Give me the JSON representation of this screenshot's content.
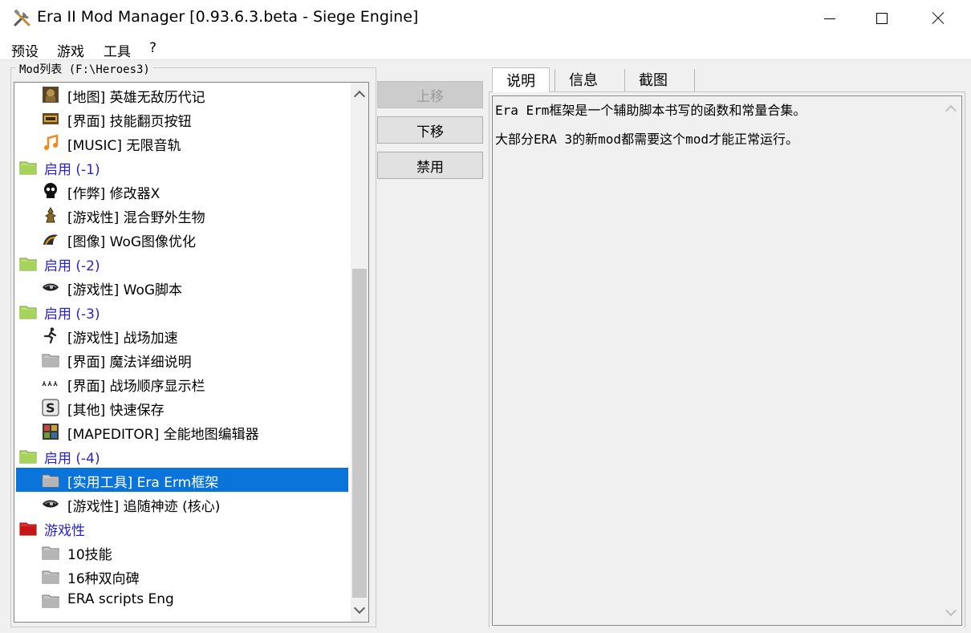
{
  "window": {
    "title": "Era II Mod Manager [0.93.6.3.beta - Siege Engine]",
    "icon": "tools-icon"
  },
  "menu": [
    "预设",
    "游戏",
    "工具",
    "?"
  ],
  "mod_list": {
    "label": "Mod列表 (F:\\Heroes3)",
    "items": [
      {
        "label": "[地图] 英雄无敌历代记",
        "icon": "map-chronicles-icon",
        "type": "mod"
      },
      {
        "label": "[界面] 技能翻页按钮",
        "icon": "skill-page-icon",
        "type": "mod"
      },
      {
        "label": "[MUSIC] 无限音轨",
        "icon": "music-note-icon",
        "type": "mod"
      },
      {
        "label": "启用 (-1)",
        "icon": "folder-green-icon",
        "type": "group"
      },
      {
        "label": "[作弊] 修改器X",
        "icon": "skull-icon",
        "type": "mod"
      },
      {
        "label": "[游戏性] 混合野外生物",
        "icon": "creature-icon",
        "type": "mod"
      },
      {
        "label": "[图像] WoG图像优化",
        "icon": "wog-graphics-icon",
        "type": "mod"
      },
      {
        "label": "启用 (-2)",
        "icon": "folder-green-icon",
        "type": "group"
      },
      {
        "label": "[游戏性] WoG脚本",
        "icon": "wog-eye-icon",
        "type": "mod"
      },
      {
        "label": "启用 (-3)",
        "icon": "folder-green-icon",
        "type": "group"
      },
      {
        "label": "[游戏性] 战场加速",
        "icon": "running-man-icon",
        "type": "mod"
      },
      {
        "label": "[界面] 魔法详细说明",
        "icon": "folder-gray-icon",
        "type": "mod"
      },
      {
        "label": "[界面] 战场顺序显示栏",
        "icon": "queue-icon",
        "type": "mod"
      },
      {
        "label": "[其他] 快速保存",
        "icon": "quicksave-icon",
        "type": "mod"
      },
      {
        "label": "[MAPEDITOR] 全能地图编辑器",
        "icon": "map-editor-icon",
        "type": "mod"
      },
      {
        "label": "启用 (-4)",
        "icon": "folder-green-icon",
        "type": "group"
      },
      {
        "label": "[实用工具] Era Erm框架",
        "icon": "folder-gray-icon",
        "type": "mod",
        "selected": true
      },
      {
        "label": "[游戏性] 追随神迹 (核心)",
        "icon": "wog-eye-icon",
        "type": "mod"
      },
      {
        "label": "游戏性",
        "icon": "folder-red-icon",
        "type": "group"
      },
      {
        "label": "10技能",
        "icon": "folder-gray-icon",
        "type": "mod"
      },
      {
        "label": "16种双向碑",
        "icon": "folder-gray-icon",
        "type": "mod"
      },
      {
        "label": "ERA scripts Eng",
        "icon": "folder-gray-icon",
        "type": "mod"
      }
    ]
  },
  "buttons": {
    "move_up": "上移",
    "move_down": "下移",
    "disable": "禁用"
  },
  "tabs": [
    {
      "label": "说明",
      "active": true
    },
    {
      "label": "信息",
      "active": false
    },
    {
      "label": "截图",
      "active": false
    }
  ],
  "description": {
    "lines": [
      "Era Erm框架是一个辅助脚本书写的函数和常量合集。",
      "大部分ERA 3的新mod都需要这个mod才能正常运行。"
    ]
  },
  "colors": {
    "selection": "#0a74da",
    "group_text": "#2a22cc",
    "folder_green": "#9acd32",
    "folder_red": "#cc1111"
  }
}
